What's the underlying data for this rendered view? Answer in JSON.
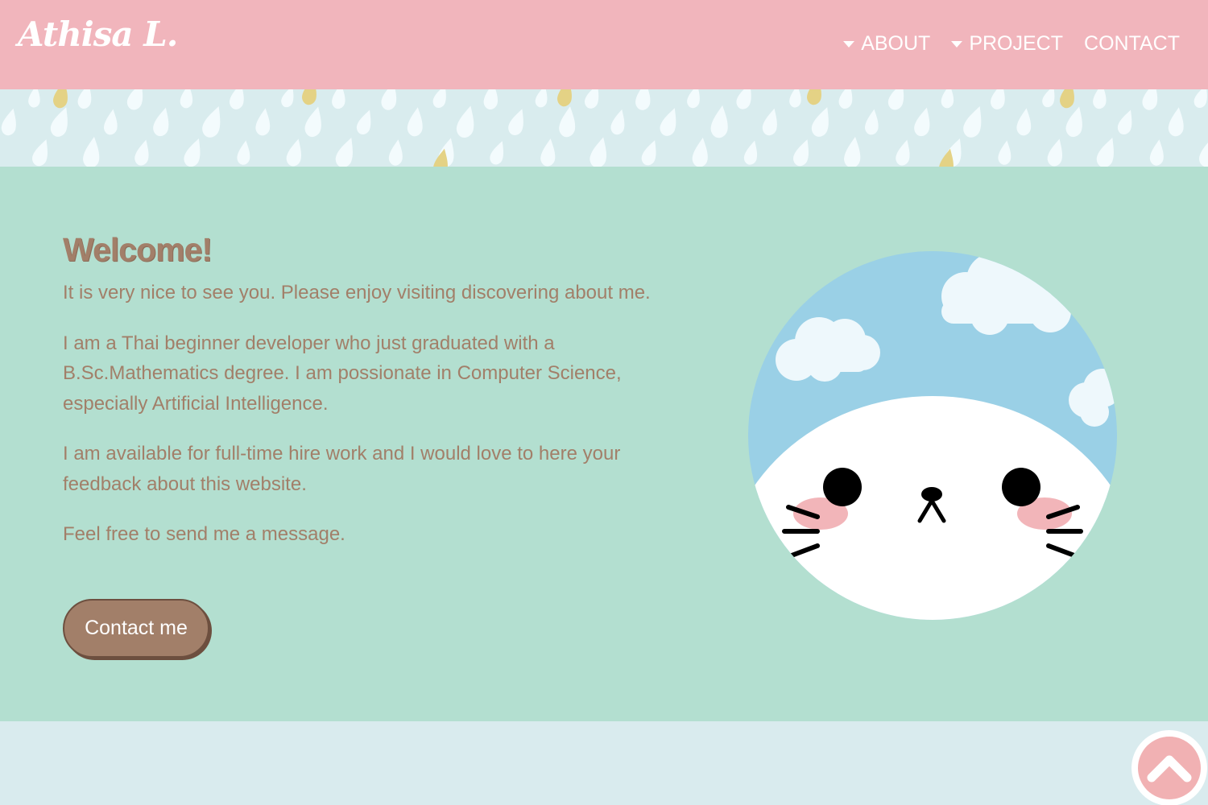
{
  "header": {
    "logo_text": "Athisa L.",
    "nav": [
      {
        "label": "ABOUT",
        "has_dropdown": true
      },
      {
        "label": "PROJECT",
        "has_dropdown": true
      },
      {
        "label": "CONTACT",
        "has_dropdown": false
      }
    ]
  },
  "banner": {
    "pattern": "raindrops",
    "background_color": "#d9ecee",
    "drop_color": "#f3fbfd",
    "accent_drop_color": "#e4d285"
  },
  "main": {
    "title": "Welcome!",
    "paragraphs": [
      "It is very nice to see you. Please enjoy visiting discovering about me.",
      "I am a Thai beginner developer who just graduated with a B.Sc.Mathematics degree. I am possionate in Computer Science, especially Artificial Intelligence.",
      "I am available for full-time hire work and I would love to here your feedback about this website.",
      "Feel free to send me a message."
    ],
    "contact_button_label": "Contact me",
    "avatar_icon": "cat-face-icon"
  },
  "footer": {
    "back_to_top_icon": "chevron-up-icon"
  },
  "colors": {
    "header_bg": "#f1b5bc",
    "main_bg": "#b3dfd0",
    "text_brown": "#a27f69",
    "footer_bg": "#d9ebee",
    "accent_pink": "#f1b1b3",
    "sky_blue": "#9ad0e6"
  }
}
